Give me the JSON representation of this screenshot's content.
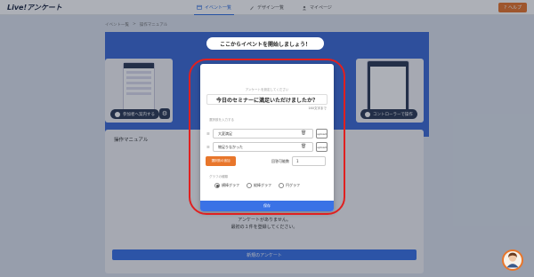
{
  "app": {
    "logo": "Live!アンケート"
  },
  "nav": {
    "items": [
      {
        "label": "イベント一覧",
        "icon": "calendar-icon",
        "active": true
      },
      {
        "label": "デザイン一覧",
        "icon": "brush-icon",
        "active": false
      },
      {
        "label": "マイページ",
        "icon": "user-icon",
        "active": false
      }
    ],
    "help_label": "ヘルプ"
  },
  "breadcrumb": {
    "root": "イベント一覧",
    "sep": ">",
    "current": "操作マニュアル"
  },
  "hero": {
    "title": "ここからイベントを開始しましょう！",
    "participant_button": "参加者へ案内する",
    "controller_button": "コントローラーで操作"
  },
  "manual": {
    "title": "操作マニュアル",
    "empty_line1": "アンケートがありません。",
    "empty_line2": "最初の１件を登録してください。",
    "new_button": "新規のアンケート"
  },
  "modal": {
    "subtitle": "アンケートを設定してください",
    "question": "今日のセミナーに満足いただけましたか？",
    "char_count": "160文字まで",
    "options_label": "選択肢を入力する",
    "options": [
      {
        "label": "大変満足",
        "upload": "upload"
      },
      {
        "label": "物足りなかった",
        "upload": "upload"
      }
    ],
    "add_option": "選択肢の追加",
    "max_label": "回答可能数",
    "max_value": "1",
    "graph_label": "グラフの種類",
    "graph_types": [
      {
        "label": "横棒グラフ",
        "selected": true
      },
      {
        "label": "縦棒グラフ",
        "selected": false
      },
      {
        "label": "円グラフ",
        "selected": false
      }
    ],
    "save": "保存"
  },
  "colors": {
    "accent": "#3a72e6",
    "orange": "#e8762b",
    "highlight": "#e02020"
  }
}
